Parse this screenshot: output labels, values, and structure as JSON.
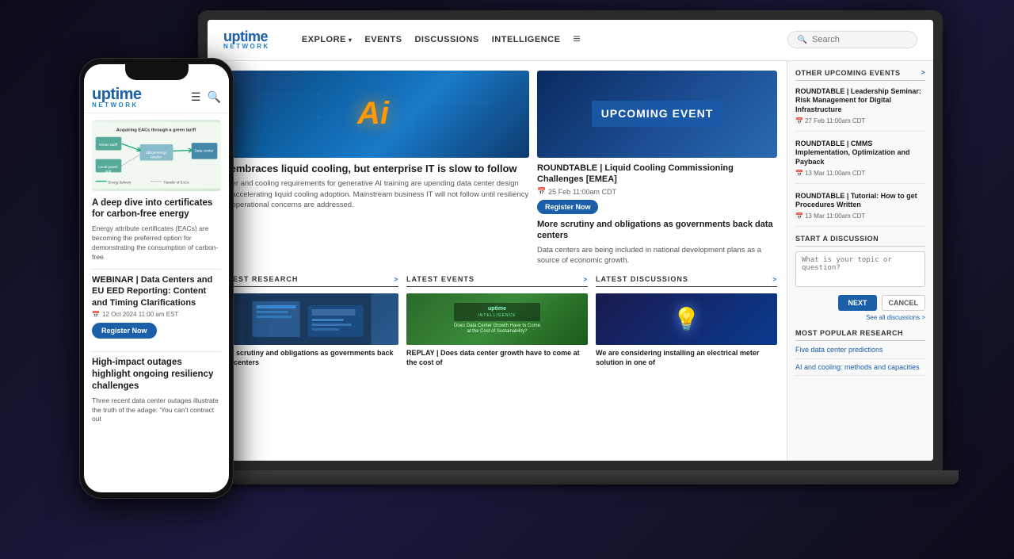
{
  "laptop": {
    "nav": {
      "logo_text": "uptime",
      "logo_sub": "NETWORK",
      "links": [
        {
          "label": "EXPLORE",
          "has_arrow": true
        },
        {
          "label": "EVENTS",
          "has_arrow": false
        },
        {
          "label": "DISCUSSIONS",
          "has_arrow": false
        },
        {
          "label": "INTELLIGENCE",
          "has_arrow": false
        }
      ],
      "hamburger_label": "≡",
      "search_placeholder": "Search"
    },
    "hero": {
      "article": {
        "img_label": "Ai",
        "title": "AI embraces liquid cooling, but enterprise IT is slow to follow",
        "description": "Power and cooling requirements for generative AI training are upending data center design and accelerating liquid cooling adoption. Mainstream business IT will not follow until resiliency and operational concerns are addressed."
      },
      "event": {
        "badge_line1": "UPCOMING EVENT",
        "title": "ROUNDTABLE | Liquid Cooling Commissioning Challenges [EMEA]",
        "date": "25 Feb   11:00am CDT",
        "register_btn": "Register Now",
        "desc_title": "More scrutiny and obligations as governments back data centers",
        "desc": "Data centers are being included in national development plans as a source of economic growth."
      }
    },
    "sections": {
      "research": {
        "header": "LATEST RESEARCH",
        "link": ">",
        "article_title": "More scrutiny and obligations as governments back data centers"
      },
      "events": {
        "header": "LATEST EVENTS",
        "link": ">",
        "article_title": "REPLAY | Does data center growth have to come at the cost of"
      },
      "discussions": {
        "header": "LATEST DISCUSSIONS",
        "link": ">",
        "article_title": "We are considering installing an electrical meter solution in one of"
      }
    },
    "sidebar": {
      "upcoming_events_title": "OTHER UPCOMING EVENTS",
      "upcoming_events_link": ">",
      "events": [
        {
          "title": "ROUNDTABLE | Leadership Seminar: Risk Management for Digital Infrastructure",
          "date": "27 Feb   11:00am CDT"
        },
        {
          "title": "ROUNDTABLE | CMMS Implementation, Optimization and Payback",
          "date": "13 Mar   11:00am CDT"
        },
        {
          "title": "ROUNDTABLE | Tutorial: How to get Procedures Written",
          "date": "13 Mar   11:00am CDT"
        }
      ],
      "discussion_title": "START A DISCUSSION",
      "discussion_placeholder": "What is your topic or question?",
      "btn_next": "NEXT",
      "btn_cancel": "CANCEL",
      "see_all_link": "See all discussions >",
      "popular_title": "MOST POPULAR RESEARCH",
      "popular_items": [
        "Five data center predictions",
        "AI and cooling: methods and capacities"
      ]
    }
  },
  "phone": {
    "logo_text": "uptime",
    "logo_sub": "NETWORK",
    "featured_img_label": "Acquiring EACs through a green tariff diagram",
    "article1": {
      "title": "A deep dive into certificates for carbon-free energy",
      "description": "Energy attribute certificates (EACs) are becoming the preferred option for demonstrating the consumption of carbon-free"
    },
    "webinar": {
      "title": "WEBINAR | Data Centers and EU EED Reporting: Content and Timing Clarifications",
      "date": "12 Oct 2024 11:00 am EST",
      "register_btn": "Register Now"
    },
    "article2": {
      "title": "High-impact outages highlight ongoing resiliency challenges",
      "description": "Three recent data center outages illustrate the truth of the adage: 'You can't contract out"
    }
  }
}
